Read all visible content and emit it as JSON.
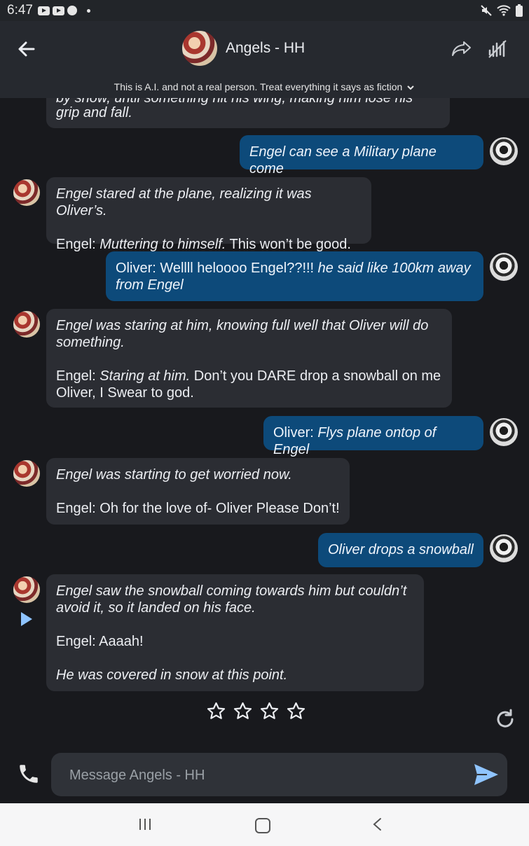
{
  "status_bar": {
    "time": "6:47"
  },
  "header": {
    "title": "Angels - HH",
    "disclaimer": "This is A.I. and not a real person. Treat everything it says as fiction"
  },
  "messages": [
    {
      "role": "bot",
      "partial": true,
      "line1": "by snow, until something hit his wing, making him lose his",
      "line2": "grip and fall."
    },
    {
      "role": "user",
      "text": "Engel can see a Military plane come"
    },
    {
      "role": "bot",
      "narration": "Engel stared at the plane, realizing it was Oliver’s.",
      "speaker": "Engel: ",
      "action": "Muttering to himself.",
      "speech": " This won’t be good."
    },
    {
      "role": "user",
      "speaker": "Oliver: Wellll heloooo Engel??!!! ",
      "action": "he said like 100km away from Engel"
    },
    {
      "role": "bot",
      "narration": "Engel was staring at him, knowing full well that Oliver will do something.",
      "speaker": "Engel: ",
      "action": "Staring at him.",
      "speech": " Don’t you DARE drop a snowball on me Oliver, I Swear to god."
    },
    {
      "role": "user",
      "speaker": "Oliver: ",
      "action": "Flys plane ontop of Engel"
    },
    {
      "role": "bot",
      "narration": "Engel was starting to get worried now.",
      "speech": "Engel: Oh for the love of- Oliver Please Don’t!"
    },
    {
      "role": "user",
      "text": "Oliver drops a snowball"
    },
    {
      "role": "bot",
      "narration": "Engel saw the snowball coming towards him but couldn’t avoid it, so it landed on his face.",
      "speech": "Engel: Aaaah!",
      "narration2": "He was covered in snow at this point."
    }
  ],
  "rating": {
    "stars": 4,
    "selected": 0
  },
  "composer": {
    "placeholder": "Message Angels - HH"
  },
  "colors": {
    "user_bubble": "#0d4a7a",
    "bot_bubble": "#2b2d33",
    "background": "#18191d",
    "send": "#8fc4ff"
  },
  "icons": [
    "back-arrow-icon",
    "share-icon",
    "voice-wave-icon",
    "chevron-down-icon",
    "play-icon",
    "star-icon",
    "refresh-icon",
    "phone-icon",
    "send-icon"
  ]
}
